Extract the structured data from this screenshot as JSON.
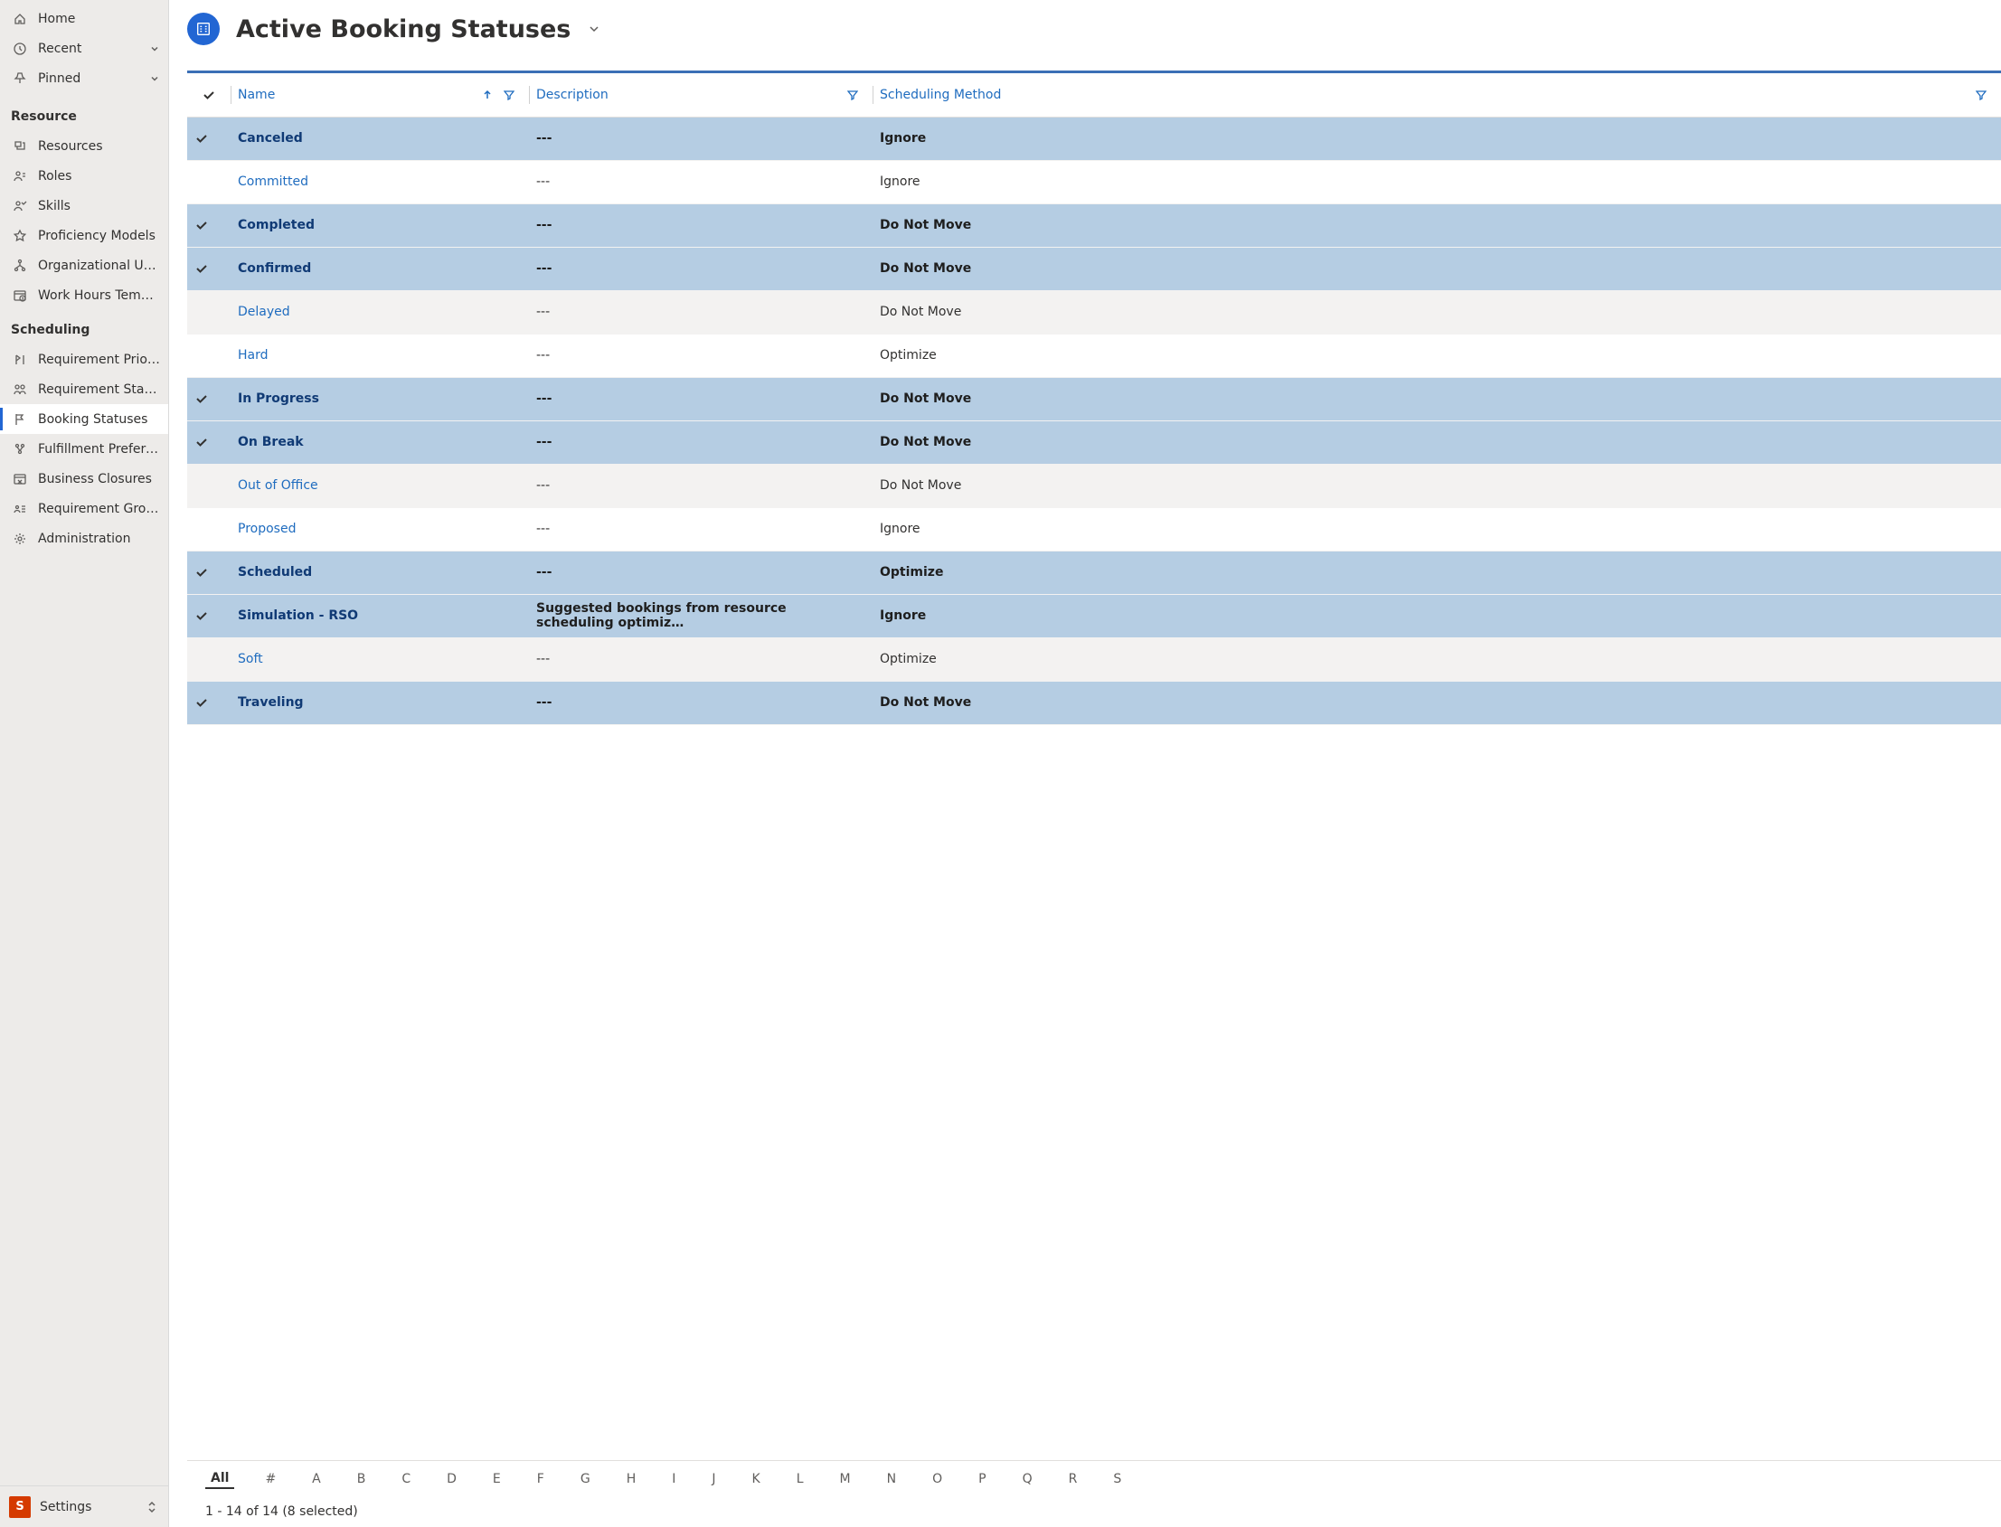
{
  "sidebar": {
    "top": [
      {
        "label": "Home",
        "icon": "home"
      },
      {
        "label": "Recent",
        "icon": "clock",
        "expandable": true
      },
      {
        "label": "Pinned",
        "icon": "pin",
        "expandable": true
      }
    ],
    "groups": [
      {
        "heading": "Resource",
        "items": [
          {
            "label": "Resources",
            "icon": "resources"
          },
          {
            "label": "Roles",
            "icon": "roles"
          },
          {
            "label": "Skills",
            "icon": "skills"
          },
          {
            "label": "Proficiency Models",
            "icon": "star"
          },
          {
            "label": "Organizational Units",
            "icon": "org"
          },
          {
            "label": "Work Hours Templates",
            "icon": "workhours"
          }
        ]
      },
      {
        "heading": "Scheduling",
        "items": [
          {
            "label": "Requirement Priorities",
            "icon": "priority"
          },
          {
            "label": "Requirement Statuses",
            "icon": "reqstatus"
          },
          {
            "label": "Booking Statuses",
            "icon": "flag",
            "active": true
          },
          {
            "label": "Fulfillment Preferences",
            "icon": "fulfill"
          },
          {
            "label": "Business Closures",
            "icon": "closure"
          },
          {
            "label": "Requirement Group ...",
            "icon": "reqgroup"
          },
          {
            "label": "Administration",
            "icon": "gear"
          }
        ]
      }
    ],
    "footer": {
      "avatar": "S",
      "label": "Settings"
    }
  },
  "header": {
    "title": "Active Booking Statuses"
  },
  "columns": {
    "name": "Name",
    "description": "Description",
    "method": "Scheduling Method"
  },
  "rows": [
    {
      "selected": true,
      "name": "Canceled",
      "desc": "---",
      "method": "Ignore"
    },
    {
      "selected": false,
      "name": "Committed",
      "desc": "---",
      "method": "Ignore"
    },
    {
      "selected": true,
      "name": "Completed",
      "desc": "---",
      "method": "Do Not Move"
    },
    {
      "selected": true,
      "name": "Confirmed",
      "desc": "---",
      "method": "Do Not Move"
    },
    {
      "selected": false,
      "name": "Delayed",
      "desc": "---",
      "method": "Do Not Move",
      "stripe": true
    },
    {
      "selected": false,
      "name": "Hard",
      "desc": "---",
      "method": "Optimize"
    },
    {
      "selected": true,
      "name": "In Progress",
      "desc": "---",
      "method": "Do Not Move"
    },
    {
      "selected": true,
      "name": "On Break",
      "desc": "---",
      "method": "Do Not Move"
    },
    {
      "selected": false,
      "name": "Out of Office",
      "desc": "---",
      "method": "Do Not Move",
      "stripe": true
    },
    {
      "selected": false,
      "name": "Proposed",
      "desc": "---",
      "method": "Ignore"
    },
    {
      "selected": true,
      "name": "Scheduled",
      "desc": "---",
      "method": "Optimize"
    },
    {
      "selected": true,
      "name": "Simulation - RSO",
      "desc": "Suggested bookings from resource scheduling optimiz…",
      "method": "Ignore"
    },
    {
      "selected": false,
      "name": "Soft",
      "desc": "---",
      "method": "Optimize",
      "stripe": true
    },
    {
      "selected": true,
      "name": "Traveling",
      "desc": "---",
      "method": "Do Not Move"
    }
  ],
  "alpha": [
    "All",
    "#",
    "A",
    "B",
    "C",
    "D",
    "E",
    "F",
    "G",
    "H",
    "I",
    "J",
    "K",
    "L",
    "M",
    "N",
    "O",
    "P",
    "Q",
    "R",
    "S"
  ],
  "status": "1 - 14 of 14 (8 selected)"
}
